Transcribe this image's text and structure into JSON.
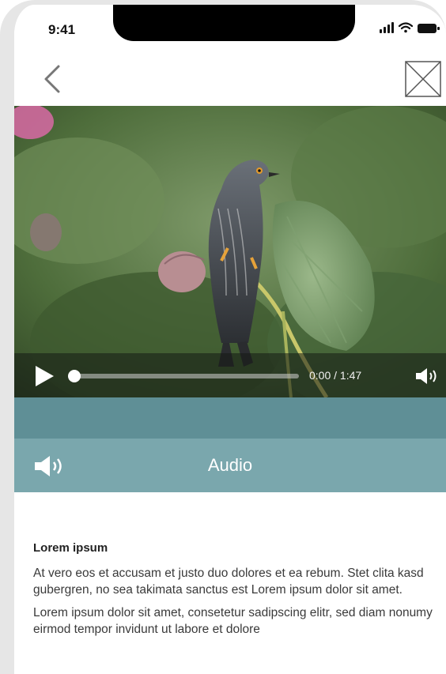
{
  "status_bar": {
    "time": "9:41",
    "icons": [
      "signal-icon",
      "wifi-icon",
      "battery-icon"
    ]
  },
  "nav": {
    "back_icon": "chevron-left-icon",
    "placeholder_icon": "image-placeholder-icon"
  },
  "video": {
    "time": "0:00 / 1:47",
    "progress_fraction": 0.0
  },
  "audio": {
    "label": "Audio",
    "icon": "speaker-icon"
  },
  "article": {
    "heading": "Lorem ipsum",
    "paragraphs": [
      "At vero eos et accusam et justo duo dolores et ea rebum. Stet clita kasd gubergren, no sea takimata sanctus est Lorem ipsum dolor sit amet.",
      "Lorem ipsum dolor sit amet, consetetur sadipscing elitr, sed diam nonumy eirmod tempor invidunt ut labore et dolore"
    ]
  },
  "colors": {
    "band_dark": "#5f8f96",
    "band_light": "#7aa7ad",
    "frame": "#e6e6e6"
  }
}
